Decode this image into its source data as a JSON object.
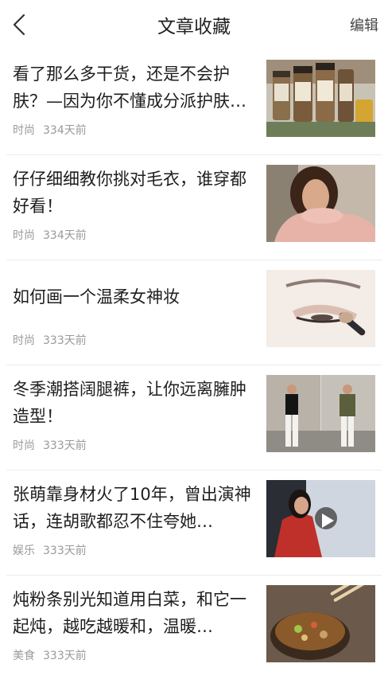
{
  "header": {
    "title": "文章收藏",
    "edit_label": "编辑",
    "back_icon": "chevron-left-icon"
  },
  "articles": [
    {
      "title": "看了那么多干货，还是不会护肤？—因为你不懂成分派护肤…",
      "category": "时尚",
      "time": "334天前",
      "thumb": "skincare-jars"
    },
    {
      "title": "仔仔细细教你挑对毛衣，谁穿都好看！",
      "category": "时尚",
      "time": "334天前",
      "thumb": "sweater-model"
    },
    {
      "title": "如何画一个温柔女神妆",
      "category": "时尚",
      "time": "333天前",
      "thumb": "eye-makeup"
    },
    {
      "title": "冬季潮搭阔腿裤，让你远离臃肿造型！",
      "category": "时尚",
      "time": "333天前",
      "thumb": "street-style"
    },
    {
      "title": "张萌靠身材火了10年，曾出演神话，连胡歌都忍不住夸她…",
      "category": "娱乐",
      "time": "333天前",
      "thumb": "video-actress"
    },
    {
      "title": "炖粉条别光知道用白菜，和它一起炖，越吃越暖和，温暖…",
      "category": "美食",
      "time": "333天前",
      "thumb": "stew-pot"
    }
  ]
}
